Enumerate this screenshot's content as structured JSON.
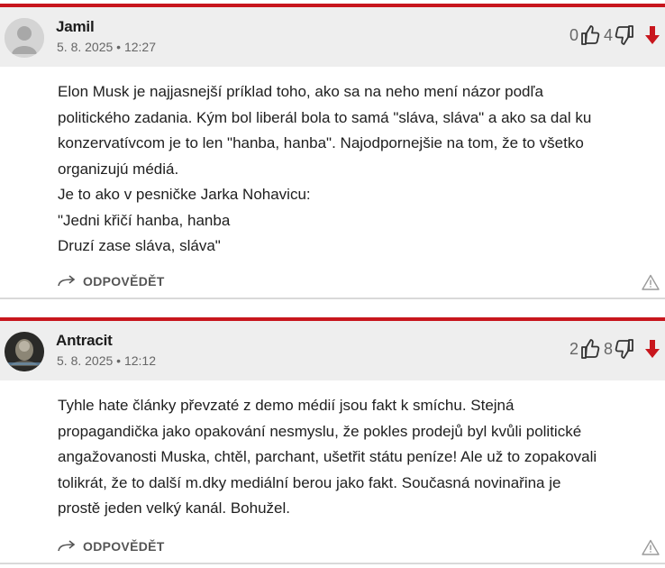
{
  "comments": [
    {
      "author": "Jamil",
      "date": "5. 8. 2025",
      "time": "12:27",
      "meta": "5. 8. 2025 • 12:27",
      "likes": "0",
      "dislikes": "4",
      "avatar": "default-avatar",
      "lines": [
        "Elon Musk je najjasnejší príklad toho, ako sa na neho mení názor podľa",
        "politického zadania. Kým bol liberál bola to samá \"sláva, sláva\" a ako sa dal ku",
        "konzervatívcom je to len \"hanba, hanba\". Najodpornejšie na tom, že to všetko",
        "organizujú médiá.",
        "Je to ako v pesničke Jarka Nohavicu:",
        "\"Jedni křičí hanba, hanba",
        "Druzí zase sláva, sláva\""
      ],
      "reply_label": "ODPOVĚDĚT"
    },
    {
      "author": "Antracit",
      "date": "5. 8. 2025",
      "time": "12:12",
      "meta": "5. 8. 2025 • 12:12",
      "likes": "2",
      "dislikes": "8",
      "avatar": "photo-avatar",
      "lines": [
        "Tyhle hate články převzaté z demo médií jsou fakt k smíchu. Stejná",
        "propagandička jako opakování nesmyslu, že pokles prodejů byl kvůli politické",
        "angažovanosti Muska, chtěl, parchant, ušetřit státu peníze! Ale už to zopakovali",
        "tolikrát, že to další m.dky mediální berou jako fakt. Současná novinařina je",
        "prostě jeden velký kanál. Bohužel."
      ],
      "reply_label": "ODPOVĚDĚT"
    }
  ],
  "icons": {
    "like": "thumbs-up-icon",
    "dislike": "thumbs-down-icon",
    "downvote": "red-down-arrow-icon",
    "reply": "reply-arrow-icon",
    "report": "warning-triangle-icon"
  },
  "colors": {
    "accent": "#c8161d",
    "header_bg": "#eeeeee",
    "meta_text": "#666666"
  }
}
